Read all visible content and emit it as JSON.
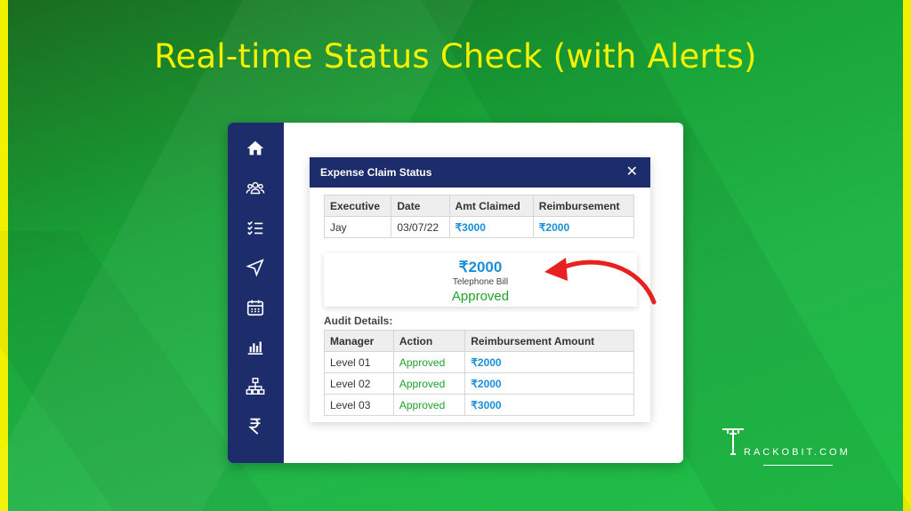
{
  "headline": "Real-time Status Check (with Alerts)",
  "sidebar": {
    "icons": [
      "home-icon",
      "users-icon",
      "checklist-icon",
      "navigation-icon",
      "calendar-icon",
      "bar-chart-icon",
      "org-chart-icon",
      "rupee-icon"
    ]
  },
  "dialog": {
    "title": "Expense Claim Status",
    "close_label": "✕",
    "claim_table": {
      "headers": [
        "Executive",
        "Date",
        "Amt Claimed",
        "Reimbursement"
      ],
      "row": [
        "Jay",
        "03/07/22",
        "₹3000",
        "₹2000"
      ]
    },
    "summary": {
      "amount": "₹2000",
      "type": "Telephone Bill",
      "status": "Approved"
    },
    "audit_label": "Audit Details:",
    "audit_table": {
      "headers": [
        "Manager",
        "Action",
        "Reimbursement Amount"
      ],
      "rows": [
        [
          "Level 01",
          "Approved",
          "₹2000"
        ],
        [
          "Level 02",
          "Approved",
          "₹2000"
        ],
        [
          "Level 03",
          "Approved",
          "₹3000"
        ]
      ]
    }
  },
  "brand": {
    "logo_letter": "T",
    "text": "RACKOBIT.COM"
  },
  "colors": {
    "accent_navy": "#1d2c6b",
    "amount_blue": "#1a8fd8",
    "approved_green": "#21a02a",
    "headline_yellow": "#f4f100",
    "arrow_red": "#e8201f"
  }
}
